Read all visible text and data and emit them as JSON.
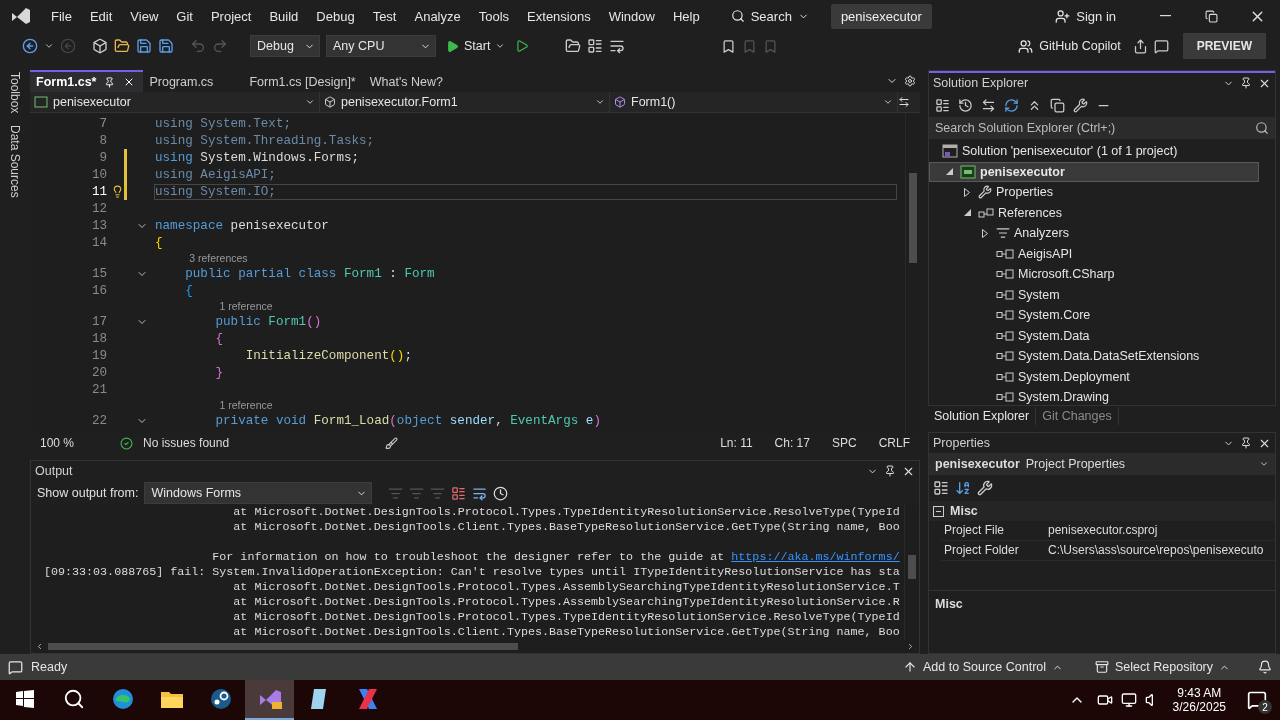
{
  "title_bar": {
    "menu": [
      "File",
      "Edit",
      "View",
      "Git",
      "Project",
      "Build",
      "Debug",
      "Test",
      "Analyze",
      "Tools",
      "Extensions",
      "Window",
      "Help"
    ],
    "search": "Search",
    "solution_name": "penisexecutor",
    "sign_in": "Sign in"
  },
  "toolbar": {
    "configuration": "Debug",
    "platform": "Any CPU",
    "start": "Start",
    "copilot": "GitHub Copilot",
    "preview": "PREVIEW"
  },
  "side_tabs": [
    "Toolbox",
    "Data Sources"
  ],
  "editor": {
    "tabs": [
      {
        "label": "Form1.cs*",
        "selected": true
      },
      {
        "label": "Program.cs",
        "selected": false
      },
      {
        "label": "Form1.cs [Design]*",
        "selected": false
      },
      {
        "label": "What's New?",
        "selected": false
      }
    ],
    "nav": [
      "penisexecutor",
      "penisexecutor.Form1",
      "Form1()"
    ],
    "lines": [
      {
        "kind": "code",
        "number": "7",
        "changed": false,
        "current": false,
        "foldable": false,
        "tokens": [
          {
            "kind": "dim",
            "text": "using System.Text;"
          }
        ]
      },
      {
        "kind": "code",
        "number": "8",
        "changed": false,
        "current": false,
        "foldable": false,
        "tokens": [
          {
            "kind": "dim",
            "text": "using System.Threading.Tasks;"
          }
        ]
      },
      {
        "kind": "code",
        "number": "9",
        "changed": true,
        "current": false,
        "foldable": false,
        "tokens": [
          {
            "kind": "keyword",
            "text": "using"
          },
          {
            "kind": "plain",
            "text": " System.Windows.Forms;"
          }
        ]
      },
      {
        "kind": "code",
        "number": "10",
        "changed": true,
        "current": false,
        "foldable": false,
        "tokens": [
          {
            "kind": "dim",
            "text": "using AeigisAPI;"
          }
        ]
      },
      {
        "kind": "code",
        "number": "11",
        "changed": true,
        "current": true,
        "foldable": false,
        "tokens": [
          {
            "kind": "dim",
            "text": "using System.IO;"
          }
        ]
      },
      {
        "kind": "code",
        "number": "12",
        "changed": false,
        "current": false,
        "foldable": false
      },
      {
        "kind": "code",
        "number": "13",
        "changed": false,
        "current": false,
        "foldable": true,
        "tokens": [
          {
            "kind": "keyword",
            "text": "namespace"
          },
          {
            "kind": "plain",
            "text": " penisexecutor"
          }
        ]
      },
      {
        "kind": "code",
        "number": "14",
        "changed": false,
        "current": false,
        "foldable": false,
        "tokens": [
          {
            "kind": "brace1",
            "text": "{"
          }
        ]
      },
      {
        "kind": "codelens",
        "text": "3 references"
      },
      {
        "kind": "code",
        "number": "15",
        "changed": false,
        "current": false,
        "foldable": true,
        "tokens": [
          {
            "kind": "keyword",
            "text": "    public partial class"
          },
          {
            "kind": "type",
            "text": " Form1"
          },
          {
            "kind": "plain",
            "text": " : "
          },
          {
            "kind": "type",
            "text": "Form"
          }
        ]
      },
      {
        "kind": "code",
        "number": "16",
        "changed": false,
        "current": false,
        "foldable": false,
        "tokens": [
          {
            "kind": "brace3",
            "text": "    {"
          }
        ]
      },
      {
        "kind": "codelens",
        "text": "1 reference"
      },
      {
        "kind": "code",
        "number": "17",
        "changed": false,
        "current": false,
        "foldable": true,
        "tokens": [
          {
            "kind": "keyword",
            "text": "        public"
          },
          {
            "kind": "type",
            "text": " Form1"
          },
          {
            "kind": "brace2",
            "text": "()"
          }
        ]
      },
      {
        "kind": "code",
        "number": "18",
        "changed": false,
        "current": false,
        "foldable": false,
        "tokens": [
          {
            "kind": "brace2",
            "text": "        {"
          }
        ]
      },
      {
        "kind": "code",
        "number": "19",
        "changed": false,
        "current": false,
        "foldable": false,
        "tokens": [
          {
            "kind": "method",
            "text": "            InitializeComponent"
          },
          {
            "kind": "brace1",
            "text": "()"
          },
          {
            "kind": "plain",
            "text": ";"
          }
        ]
      },
      {
        "kind": "code",
        "number": "20",
        "changed": false,
        "current": false,
        "foldable": false,
        "tokens": [
          {
            "kind": "brace2",
            "text": "        }"
          }
        ]
      },
      {
        "kind": "code",
        "number": "21",
        "changed": false,
        "current": false,
        "foldable": false
      },
      {
        "kind": "codelens",
        "text": "1 reference"
      },
      {
        "kind": "code",
        "number": "22",
        "changed": false,
        "current": false,
        "foldable": true,
        "tokens": [
          {
            "kind": "keyword",
            "text": "        private void"
          },
          {
            "kind": "method",
            "text": " Form1_Load"
          },
          {
            "kind": "brace2",
            "text": "("
          },
          {
            "kind": "keyword",
            "text": "object"
          },
          {
            "kind": "param",
            "text": " sender"
          },
          {
            "kind": "plain",
            "text": ", "
          },
          {
            "kind": "type",
            "text": "EventArgs"
          },
          {
            "kind": "param",
            "text": " e"
          },
          {
            "kind": "brace2",
            "text": ")"
          }
        ]
      }
    ],
    "status": {
      "zoom": "100 %",
      "issues": "No issues found",
      "line": "Ln: 11",
      "column": "Ch: 17",
      "whitespace": "SPC",
      "line_endings": "CRLF"
    }
  },
  "output": {
    "title": "Output",
    "source_label": "Show output from:",
    "source": "Windows Forms",
    "lines": [
      {
        "kind": "trace",
        "text": "at Microsoft.DotNet.DesignTools.Protocol.Types.TypeIdentityResolutionService.ResolveType(TypeId"
      },
      {
        "kind": "trace",
        "text": "at Microsoft.DotNet.DesignTools.Client.Types.BaseTypeResolutionService.GetType(String name, Boo"
      },
      {
        "kind": "blank"
      },
      {
        "kind": "info",
        "text": "For information on how to troubleshoot the designer refer to the guide at ",
        "link": "https://aka.ms/winforms/"
      },
      {
        "kind": "error",
        "text": "[09:33:03.088765] fail: System.InvalidOperationException: Can't resolve types until ITypeIdentityResolutionService has sta"
      },
      {
        "kind": "trace",
        "text": "at Microsoft.DotNet.DesignTools.Protocol.Types.AssemblySearchingTypeIdentityResolutionService.T"
      },
      {
        "kind": "trace",
        "text": "at Microsoft.DotNet.DesignTools.Protocol.Types.AssemblySearchingTypeIdentityResolutionService.R"
      },
      {
        "kind": "trace",
        "text": "at Microsoft.DotNet.DesignTools.Protocol.Types.TypeIdentityResolutionService.ResolveType(TypeId"
      },
      {
        "kind": "trace",
        "text": "at Microsoft.DotNet.DesignTools.Client.Types.BaseTypeResolutionService.GetType(String name, Boo"
      }
    ]
  },
  "solution_explorer": {
    "title": "Solution Explorer",
    "search_placeholder": "Search Solution Explorer (Ctrl+;)",
    "tree": [
      {
        "label": "Solution 'penisexecutor' (1 of 1 project)",
        "kind": "solution",
        "selected": false,
        "children": [
          {
            "label": "penisexecutor",
            "kind": "project",
            "selected": true,
            "expanded": true,
            "children": [
              {
                "label": "Properties",
                "kind": "properties",
                "selected": false,
                "expanded": false
              },
              {
                "label": "References",
                "kind": "references",
                "selected": false,
                "expanded": true,
                "children": [
                  {
                    "label": "Analyzers",
                    "kind": "analyzers",
                    "selected": false,
                    "expanded": false
                  },
                  {
                    "label": "AeigisAPI",
                    "kind": "reference",
                    "selected": false
                  },
                  {
                    "label": "Microsoft.CSharp",
                    "kind": "reference",
                    "selected": false
                  },
                  {
                    "label": "System",
                    "kind": "reference",
                    "selected": false
                  },
                  {
                    "label": "System.Core",
                    "kind": "reference",
                    "selected": false
                  },
                  {
                    "label": "System.Data",
                    "kind": "reference",
                    "selected": false
                  },
                  {
                    "label": "System.Data.DataSetExtensions",
                    "kind": "reference",
                    "selected": false
                  },
                  {
                    "label": "System.Deployment",
                    "kind": "reference",
                    "selected": false
                  },
                  {
                    "label": "System.Drawing",
                    "kind": "reference",
                    "selected": false
                  }
                ]
              }
            ]
          }
        ]
      }
    ],
    "tabs": [
      {
        "label": "Solution Explorer",
        "selected": true
      },
      {
        "label": "Git Changes",
        "selected": false
      }
    ]
  },
  "properties": {
    "title": "Properties",
    "object": "penisexecutor",
    "object_type": "Project Properties",
    "categories": [
      {
        "name": "Misc",
        "expanded": true,
        "rows": [
          {
            "name": "Project File",
            "value": "penisexecutor.csproj"
          },
          {
            "name": "Project Folder",
            "value": "C:\\Users\\ass\\source\\repos\\penisexecuto"
          }
        ]
      }
    ],
    "description_title": "Misc"
  },
  "status_bar": {
    "text": "Ready",
    "source_control": "Add to Source Control",
    "repository": "Select Repository"
  },
  "taskbar": {
    "apps": [
      {
        "kind": "edge",
        "selected": false
      },
      {
        "kind": "explorer",
        "selected": false
      },
      {
        "kind": "steam",
        "selected": false
      },
      {
        "kind": "visualstudio",
        "selected": true
      },
      {
        "kind": "notepad",
        "selected": false
      },
      {
        "kind": "ide",
        "selected": false
      }
    ],
    "time": "9:43 AM",
    "date": "3/26/2025",
    "notifications": "2"
  }
}
